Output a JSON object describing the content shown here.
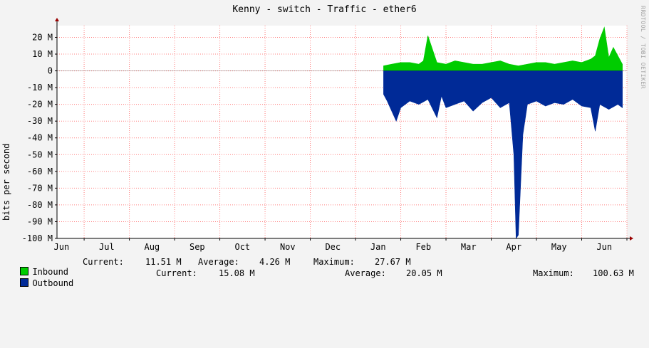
{
  "chart_data": {
    "type": "area",
    "title": "Kenny - switch - Traffic - ether6",
    "ylabel": "bits per second",
    "watermark": "RRDTOOL / TOBI OETIKER",
    "ylim": [
      -100,
      27
    ],
    "yticks": [
      20,
      10,
      0,
      -10,
      -20,
      -30,
      -40,
      -50,
      -60,
      -70,
      -80,
      -90,
      -100
    ],
    "ytick_labels": [
      "20 M",
      "10 M",
      "0",
      "-10 M",
      "-20 M",
      "-30 M",
      "-40 M",
      "-50 M",
      "-60 M",
      "-70 M",
      "-80 M",
      "-90 M",
      "-100 M"
    ],
    "xlim": [
      0,
      12.6
    ],
    "month_labels": [
      "Jun",
      "Jul",
      "Aug",
      "Sep",
      "Oct",
      "Nov",
      "Dec",
      "Jan",
      "Feb",
      "Mar",
      "Apr",
      "May",
      "Jun"
    ],
    "grid": true,
    "colors": {
      "inbound": "#00cc00",
      "outbound": "#002a97",
      "grid": "#ff8080",
      "background": "#ffffff",
      "axis": "#000000",
      "arrow": "#990000"
    },
    "series": [
      {
        "name": "Inbound",
        "x": [
          7.22,
          7.4,
          7.6,
          7.8,
          8.0,
          8.1,
          8.2,
          8.4,
          8.6,
          8.8,
          9.0,
          9.2,
          9.4,
          9.6,
          9.8,
          10.0,
          10.2,
          10.4,
          10.6,
          10.8,
          11.0,
          11.2,
          11.4,
          11.6,
          11.8,
          11.9,
          12.0,
          12.1,
          12.2,
          12.3,
          12.5
        ],
        "values": [
          3,
          4,
          5,
          5,
          4,
          6,
          21,
          5,
          4,
          6,
          5,
          4,
          4,
          5,
          6,
          4,
          3,
          4,
          5,
          5,
          4,
          5,
          6,
          5,
          7,
          9,
          19,
          26,
          8,
          14,
          4
        ]
      },
      {
        "name": "Outbound",
        "x": [
          7.22,
          7.3,
          7.4,
          7.5,
          7.6,
          7.8,
          8.0,
          8.2,
          8.4,
          8.5,
          8.6,
          8.8,
          9.0,
          9.2,
          9.4,
          9.6,
          9.8,
          10.0,
          10.1,
          10.15,
          10.2,
          10.3,
          10.4,
          10.6,
          10.8,
          11.0,
          11.2,
          11.4,
          11.6,
          11.8,
          11.9,
          12.0,
          12.2,
          12.4,
          12.5
        ],
        "values": [
          -14,
          -18,
          -24,
          -30,
          -22,
          -18,
          -20,
          -17,
          -28,
          -15,
          -22,
          -20,
          -18,
          -24,
          -19,
          -16,
          -22,
          -19,
          -50,
          -100,
          -98,
          -38,
          -20,
          -18,
          -21,
          -19,
          -20,
          -17,
          -21,
          -22,
          -36,
          -20,
          -23,
          -20,
          -22
        ]
      }
    ]
  },
  "legend": {
    "inbound": {
      "label": "Inbound",
      "current_label": "Current:",
      "current": "11.51 M",
      "average_label": "Average:",
      "average": "4.26 M",
      "maximum_label": "Maximum:",
      "maximum": "27.67 M"
    },
    "outbound": {
      "label": "Outbound",
      "current_label": "Current:",
      "current": "15.08 M",
      "average_label": "Average:",
      "average": "20.05 M",
      "maximum_label": "Maximum:",
      "maximum": "100.63 M"
    }
  }
}
